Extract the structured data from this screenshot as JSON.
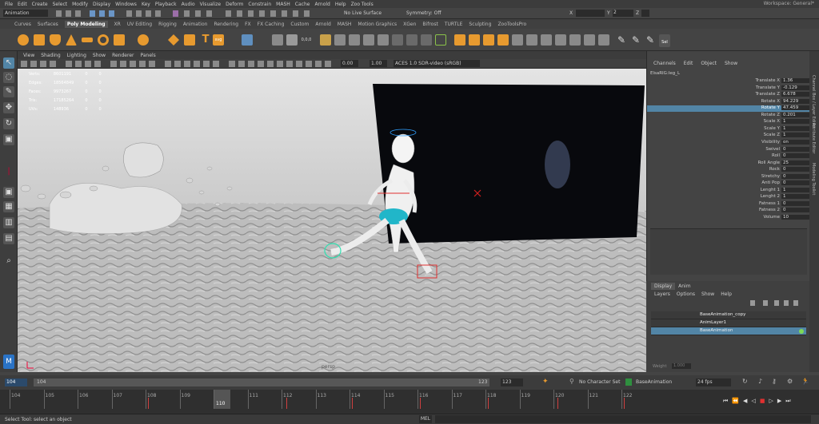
{
  "menu": [
    "File",
    "Edit",
    "Create",
    "Select",
    "Modify",
    "Display",
    "Windows",
    "Key",
    "Playback",
    "Audio",
    "Visualize",
    "Deform",
    "Constrain",
    "MASH",
    "Cache",
    "Arnold",
    "Help",
    "Zoo Tools"
  ],
  "workspace": {
    "label": "Workspace:",
    "value": "General*"
  },
  "menuset": "Animation",
  "live_surface": "No Live Surface",
  "symmetry": "Symmetry: Off",
  "coords": {
    "x_label": "X",
    "y_label": "Y",
    "z_label": "Z",
    "y_value": "2"
  },
  "shelf_tabs": [
    "Curves",
    "Surfaces",
    "Poly Modeling",
    "XR",
    "UV Editing",
    "Rigging",
    "Animation",
    "Rendering",
    "FX",
    "FX Caching",
    "Custom",
    "Arnold",
    "MASH",
    "Motion Graphics",
    "XGen",
    "Bifrost",
    "TURTLE",
    "Sculpting",
    "ZooToolsPro"
  ],
  "shelf_active": "Poly Modeling",
  "shelf_extra": [
    "vpl",
    "cast",
    "0,0,0",
    "svg",
    "Sel"
  ],
  "panel_menu": [
    "View",
    "Shading",
    "Lighting",
    "Show",
    "Renderer",
    "Panels"
  ],
  "panel_fields": {
    "exposure": "0.00",
    "gamma": "1.00",
    "colorspace": "ACES 1.0 SDR-video (sRGB)"
  },
  "hud": [
    [
      "Verts:",
      "8601191",
      "0",
      "0"
    ],
    [
      "Edges:",
      "18564849",
      "0",
      "0"
    ],
    [
      "Faces:",
      "9973267",
      "0",
      "0"
    ],
    [
      "Tris:",
      "17185264",
      "0",
      "0"
    ],
    [
      "UVs:",
      "148936",
      "0",
      "0"
    ]
  ],
  "camera_label": "persp",
  "channel_menu": [
    "Channels",
    "Edit",
    "Object",
    "Show"
  ],
  "object_name": "ElsaRIG:leg_L",
  "attributes": [
    [
      "Translate X",
      "1.36"
    ],
    [
      "Translate Y",
      "-0.129"
    ],
    [
      "Translate Z",
      "6.678"
    ],
    [
      "Rotate X",
      "94.229"
    ],
    [
      "Rotate Y",
      "47.459"
    ],
    [
      "Rotate Z",
      "0.201"
    ],
    [
      "Scale X",
      "1"
    ],
    [
      "Scale Y",
      "1"
    ],
    [
      "Scale Z",
      "1"
    ],
    [
      "Visibility",
      "on"
    ],
    [
      "Swivel",
      "0"
    ],
    [
      "Roll",
      "0"
    ],
    [
      "Roll Angle",
      "25"
    ],
    [
      "Rock",
      "0"
    ],
    [
      "Stretchy",
      "0"
    ],
    [
      "Anti Pop",
      "0"
    ],
    [
      "Lenght 1",
      "1"
    ],
    [
      "Lenght 2",
      "1"
    ],
    [
      "Fatness 1",
      "0"
    ],
    [
      "Fatness 2",
      "0"
    ],
    [
      "Volume",
      "10"
    ]
  ],
  "selected_attr": "Rotate Y",
  "layer_tabs": [
    "Display",
    "Anim"
  ],
  "layer_menu": [
    "Layers",
    "Options",
    "Show",
    "Help"
  ],
  "layers": [
    "BaseAnimation_copy",
    "AnimLayer1",
    "BaseAnimation"
  ],
  "weight_label": "Weight",
  "weight_value": "1.000",
  "right_tabs": [
    "Channel Box / Layer Editor",
    "Attribute Editor",
    "Modeling Toolkit"
  ],
  "timeslider": {
    "current": "104",
    "start": "104",
    "end": "123",
    "range_end": "123",
    "character": "No Character Set",
    "layer": "BaseAnimation",
    "fps": "24 fps"
  },
  "timeline": {
    "ticks": [
      "104",
      "105",
      "106",
      "107",
      "108",
      "109",
      "110",
      "111",
      "112",
      "113",
      "114",
      "115",
      "116",
      "117",
      "118",
      "119",
      "120",
      "121",
      "122"
    ],
    "playhead": "110"
  },
  "status_help": "Select Tool: select an object",
  "mel_label": "MEL"
}
